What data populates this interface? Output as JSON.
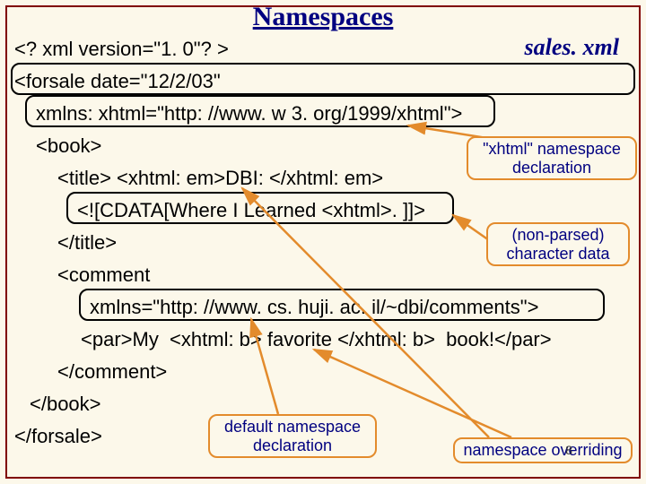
{
  "title": "Namespaces",
  "filename": "sales. xml",
  "code": {
    "l1": "<? xml version=\"1. 0\"? >",
    "l2": "<forsale date=\"12/2/03\"",
    "l3": "xmlns: xhtml=\"http: //www. w 3. org/1999/xhtml\">",
    "l4": "<book>",
    "l5": "<title> <xhtml: em>DBI: </xhtml: em>",
    "l6": "<![CDATA[Where I Learned <xhtml>. ]]>",
    "l7": "</title>",
    "l8": "<comment",
    "l9": "xmlns=\"http: //www. cs. huji. ac. il/~dbi/comments\">",
    "l10": "<par>My  <xhtml: b> favorite </xhtml: b>  book!</par>",
    "l11": "</comment>",
    "l12": "</book>",
    "l13": "</forsale>"
  },
  "annotations": {
    "xhtml_ns": "\"xhtml\" namespace\ndeclaration",
    "cdata": "(non-parsed)\ncharacter data",
    "default_ns": "default namespace\ndeclaration",
    "override": "namespace overriding"
  },
  "page_number": "8"
}
